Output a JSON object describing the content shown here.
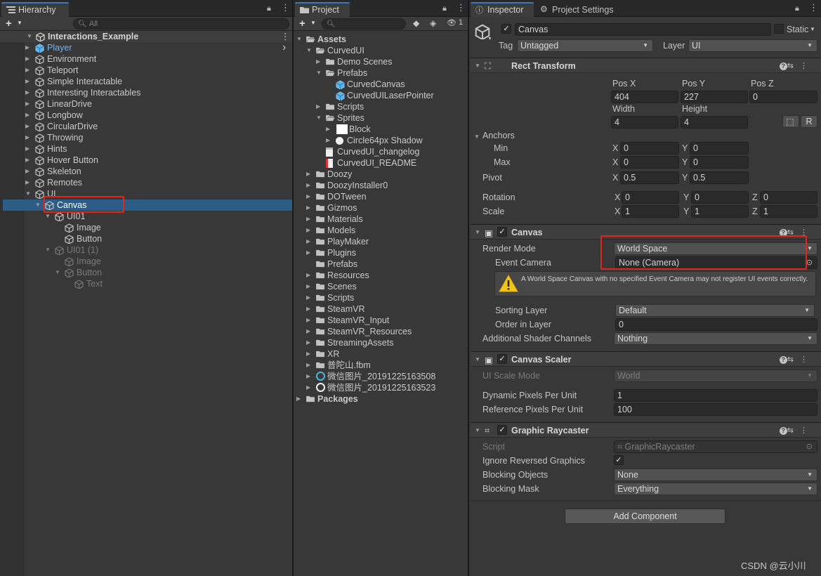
{
  "hierarchy": {
    "tab_label": "Hierarchy",
    "search_placeholder": "All",
    "scene_name": "Interactions_Example",
    "items": [
      {
        "label": "Player"
      },
      {
        "label": "Environment"
      },
      {
        "label": "Teleport"
      },
      {
        "label": "Simple Interactable"
      },
      {
        "label": "Interesting Interactables"
      },
      {
        "label": "LinearDrive"
      },
      {
        "label": "Longbow"
      },
      {
        "label": "CircularDrive"
      },
      {
        "label": "Throwing"
      },
      {
        "label": "Hints"
      },
      {
        "label": "Hover Button"
      },
      {
        "label": "Skeleton"
      },
      {
        "label": "Remotes"
      },
      {
        "label": "UI"
      },
      {
        "label": "Canvas"
      },
      {
        "label": "UI01"
      },
      {
        "label": "Image"
      },
      {
        "label": "Button"
      },
      {
        "label": "UI01 (1)"
      },
      {
        "label": "Image"
      },
      {
        "label": "Button"
      },
      {
        "label": "Text"
      }
    ]
  },
  "project": {
    "tab_label": "Project",
    "hidden_count": "1",
    "items": [
      {
        "label": "Assets"
      },
      {
        "label": "CurvedUI"
      },
      {
        "label": "Demo Scenes"
      },
      {
        "label": "Prefabs"
      },
      {
        "label": "CurvedCanvas"
      },
      {
        "label": "CurvedUILaserPointer"
      },
      {
        "label": "Scripts"
      },
      {
        "label": "Sprites"
      },
      {
        "label": "Block"
      },
      {
        "label": "Circle64px Shadow"
      },
      {
        "label": "CurvedUI_changelog"
      },
      {
        "label": "CurvedUI_README"
      },
      {
        "label": "Doozy"
      },
      {
        "label": "DoozyInstaller0"
      },
      {
        "label": "DOTween"
      },
      {
        "label": "Gizmos"
      },
      {
        "label": "Materials"
      },
      {
        "label": "Models"
      },
      {
        "label": "PlayMaker"
      },
      {
        "label": "Plugins"
      },
      {
        "label": "Prefabs"
      },
      {
        "label": "Resources"
      },
      {
        "label": "Scenes"
      },
      {
        "label": "Scripts"
      },
      {
        "label": "SteamVR"
      },
      {
        "label": "SteamVR_Input"
      },
      {
        "label": "SteamVR_Resources"
      },
      {
        "label": "StreamingAssets"
      },
      {
        "label": "XR"
      },
      {
        "label": "普陀山.fbm"
      },
      {
        "label": "微信图片_20191225163508"
      },
      {
        "label": "微信图片_20191225163523"
      },
      {
        "label": "Packages"
      }
    ]
  },
  "inspector": {
    "tab_label": "Inspector",
    "tab2_label": "Project Settings",
    "object_name": "Canvas",
    "static_label": "Static",
    "tag_label": "Tag",
    "tag_value": "Untagged",
    "layer_label": "Layer",
    "layer_value": "UI",
    "rect_transform": {
      "title": "Rect Transform",
      "posx_label": "Pos X",
      "posy_label": "Pos Y",
      "posz_label": "Pos Z",
      "posx": "404",
      "posy": "227",
      "posz": "0",
      "width_label": "Width",
      "height_label": "Height",
      "width": "4",
      "height": "4",
      "r_label": "R",
      "anchors_label": "Anchors",
      "min_label": "Min",
      "max_label": "Max",
      "min_x": "0",
      "min_y": "0",
      "max_x": "0",
      "max_y": "0",
      "pivot_label": "Pivot",
      "pivot_x": "0.5",
      "pivot_y": "0.5",
      "rotation_label": "Rotation",
      "rot_x": "0",
      "rot_y": "0",
      "rot_z": "0",
      "scale_label": "Scale",
      "scale_x": "1",
      "scale_y": "1",
      "scale_z": "1",
      "x": "X",
      "y": "Y",
      "z": "Z"
    },
    "canvas": {
      "title": "Canvas",
      "render_mode_label": "Render Mode",
      "render_mode_value": "World Space",
      "event_camera_label": "Event Camera",
      "event_camera_value": "None (Camera)",
      "warning": "A World Space Canvas with no specified Event Camera may not register UI events correctly.",
      "sorting_layer_label": "Sorting Layer",
      "sorting_layer_value": "Default",
      "order_label": "Order in Layer",
      "order_value": "0",
      "shader_label": "Additional Shader Channels",
      "shader_value": "Nothing"
    },
    "canvas_scaler": {
      "title": "Canvas Scaler",
      "scale_mode_label": "UI Scale Mode",
      "scale_mode_value": "World",
      "dyn_label": "Dynamic Pixels Per Unit",
      "dyn_value": "1",
      "ref_label": "Reference Pixels Per Unit",
      "ref_value": "100"
    },
    "raycaster": {
      "title": "Graphic Raycaster",
      "script_label": "Script",
      "script_value": "GraphicRaycaster",
      "ignore_label": "Ignore Reversed Graphics",
      "blocking_objects_label": "Blocking Objects",
      "blocking_objects_value": "None",
      "blocking_mask_label": "Blocking Mask",
      "blocking_mask_value": "Everything"
    },
    "add_component": "Add Component"
  },
  "watermark": "CSDN @云小川",
  "colors": {
    "selection": "#2c5d87",
    "highlight": "#e1261c",
    "accent_tab": "#3a79bb"
  }
}
